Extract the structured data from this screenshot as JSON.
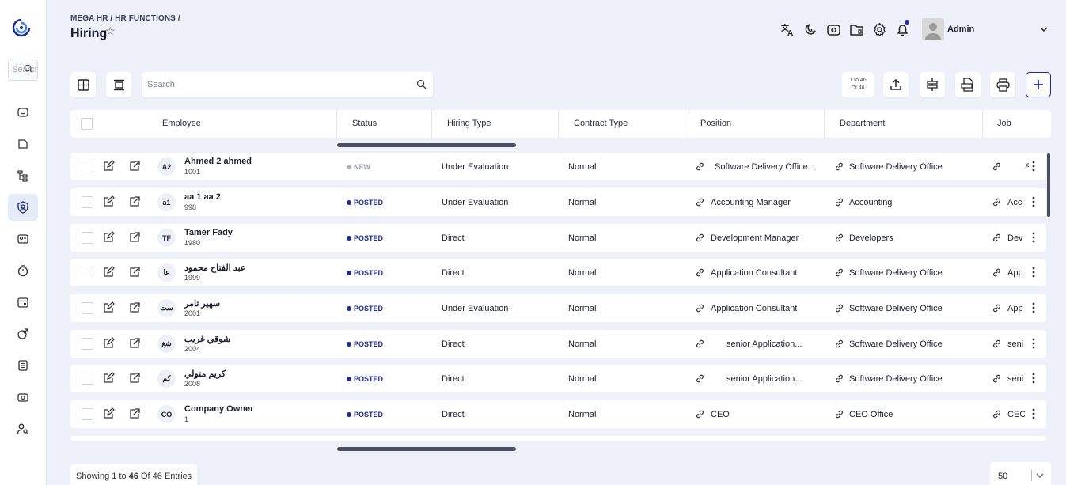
{
  "header": {
    "breadcrumb": "MEGA HR / HR FUNCTIONS /",
    "title": "Hiring",
    "user_name": "Admin"
  },
  "sidebar": {
    "search_placeholder": "Search",
    "items": [
      "home",
      "folder",
      "org-chart",
      "hiring",
      "id-card",
      "timer",
      "calendar",
      "payroll",
      "documents",
      "camera",
      "users"
    ]
  },
  "toolbar": {
    "search_placeholder": "Search",
    "pager_range": "1 to 46",
    "pager_total": "Of 46"
  },
  "table": {
    "columns": [
      "Employee",
      "Status",
      "Hiring Type",
      "Contract Type",
      "Position",
      "Department",
      "Job"
    ],
    "rows": [
      {
        "initials": "A2",
        "name": "Ahmed 2 ahmed",
        "code": "1001",
        "status": "NEW",
        "hiring_type": "Under Evaluation",
        "contract_type": "Normal",
        "position": "Software Delivery Office..",
        "department": "Software Delivery Office",
        "job": "S"
      },
      {
        "initials": "a1",
        "name": "aa 1 aa 2",
        "code": "998",
        "status": "POSTED",
        "hiring_type": "Under Evaluation",
        "contract_type": "Normal",
        "position": "Accounting Manager",
        "department": "Accounting",
        "job": "Acc"
      },
      {
        "initials": "TF",
        "name": "Tamer Fady",
        "code": "1980",
        "status": "POSTED",
        "hiring_type": "Direct",
        "contract_type": "Normal",
        "position": "Development Manager",
        "department": "Developers",
        "job": "Dev"
      },
      {
        "initials": "عا",
        "name": "عبد الفتاح محمود",
        "code": "1999",
        "status": "POSTED",
        "hiring_type": "Direct",
        "contract_type": "Normal",
        "position": "Application Consultant",
        "department": "Software Delivery Office",
        "job": "App"
      },
      {
        "initials": "ست",
        "name": "سهير تامر",
        "code": "2001",
        "status": "POSTED",
        "hiring_type": "Under Evaluation",
        "contract_type": "Normal",
        "position": "Application Consultant",
        "department": "Software Delivery Office",
        "job": "App"
      },
      {
        "initials": "شغ",
        "name": "شوقي غريب",
        "code": "2004",
        "status": "POSTED",
        "hiring_type": "Direct",
        "contract_type": "Normal",
        "position": "senior Application...",
        "department": "Software Delivery Office",
        "job": "seni"
      },
      {
        "initials": "كم",
        "name": "كريم متولي",
        "code": "2008",
        "status": "POSTED",
        "hiring_type": "Direct",
        "contract_type": "Normal",
        "position": "senior Application...",
        "department": "Software Delivery Office",
        "job": "seni"
      },
      {
        "initials": "CO",
        "name": "Company Owner",
        "code": "1",
        "status": "POSTED",
        "hiring_type": "Direct",
        "contract_type": "Normal",
        "position": "CEO",
        "department": "CEO Office",
        "job": "CEC"
      }
    ]
  },
  "footer": {
    "showing_prefix": "Showing 1 to",
    "showing_count": "46",
    "showing_suffix": "Of 46 Entries",
    "page_size": "50"
  },
  "colors": {
    "accent": "#1a2b9e",
    "background": "#eef1fa"
  }
}
